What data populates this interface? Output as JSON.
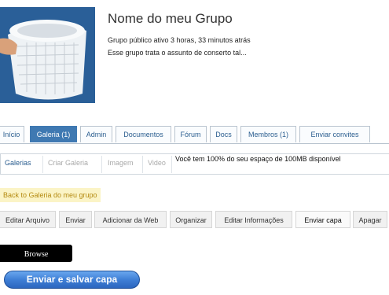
{
  "group": {
    "name": "Nome do meu Grupo",
    "status": "Grupo público ativo 3 horas, 33 minutos atrás",
    "description": "Esse grupo trata o assunto de conserto tal..."
  },
  "tabs": [
    {
      "label": "Início"
    },
    {
      "label": "Galeria (1)",
      "active": true
    },
    {
      "label": "Admin"
    },
    {
      "label": "Documentos"
    },
    {
      "label": "Fórum"
    },
    {
      "label": "Docs"
    },
    {
      "label": "Membros (1)"
    },
    {
      "label": "Enviar convites"
    }
  ],
  "gallery_nav": {
    "items": [
      {
        "label": "Galerias",
        "enabled": true
      },
      {
        "label": "Criar Galeria",
        "enabled": false
      },
      {
        "label": "Imagem",
        "enabled": false
      },
      {
        "label": "Video",
        "enabled": false
      }
    ],
    "quota_text": "Você tem 100% do seu espaço de 100MB disponível"
  },
  "back_link": "Back to Galeria do meu grupo",
  "actions": [
    {
      "label": "Editar Arquivo"
    },
    {
      "label": "Enviar"
    },
    {
      "label": "Adicionar da Web"
    },
    {
      "label": "Organizar"
    },
    {
      "label": "Editar Informações"
    },
    {
      "label": "Enviar capa",
      "active": true
    },
    {
      "label": "Apagar"
    }
  ],
  "browse_label": "Browse",
  "submit_label": "Enviar e salvar capa",
  "colors": {
    "active_tab": "#3f79b2",
    "link": "#2a5d8f",
    "back_link_bg": "#fbf4c6",
    "submit_button": "#3f7fd6"
  }
}
